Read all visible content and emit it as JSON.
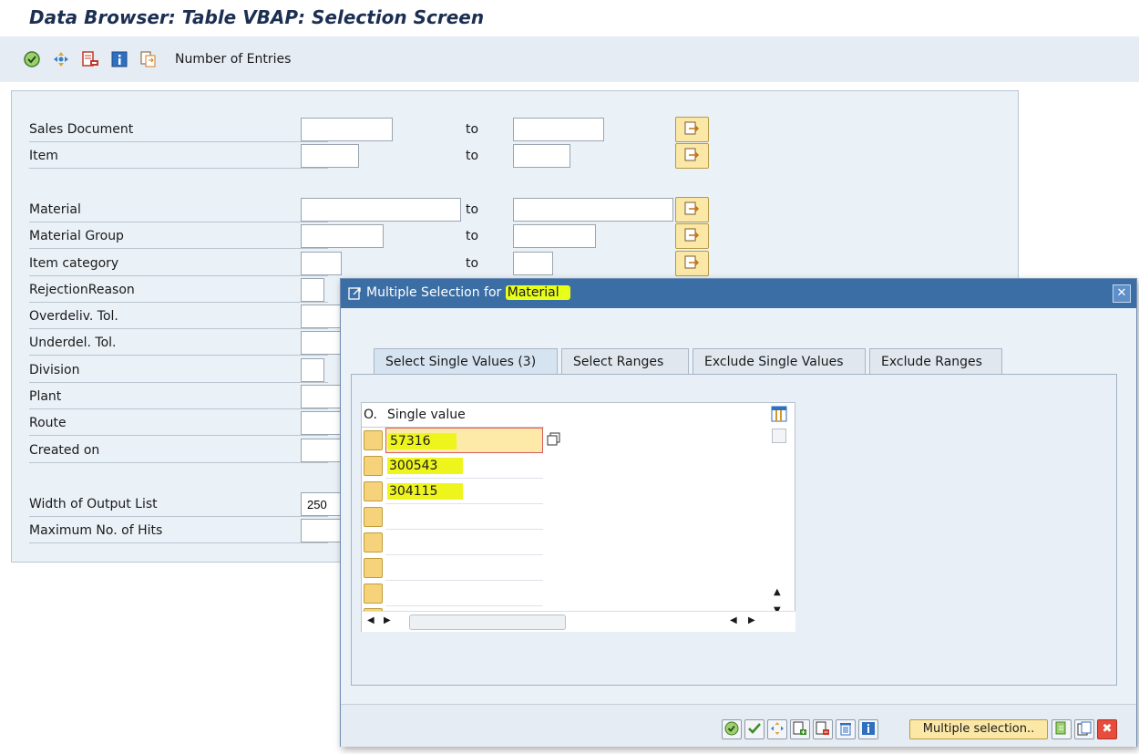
{
  "window": {
    "title": "Data Browser: Table VBAP: Selection Screen"
  },
  "toolbar": {
    "icons": [
      "execute-icon",
      "selection-options-icon",
      "delete-selection-icon",
      "info-icon",
      "multiple-selection-icon"
    ],
    "number_of_entries_label": "Number of Entries"
  },
  "selection": {
    "to_label": "to",
    "fields": [
      {
        "label": "Sales Document",
        "low": "",
        "high": ""
      },
      {
        "label": "Item",
        "low": "",
        "high": ""
      },
      {
        "label": "Material",
        "low": "",
        "high": ""
      },
      {
        "label": "Material Group",
        "low": "",
        "high": ""
      },
      {
        "label": "Item category",
        "low": "",
        "high": ""
      },
      {
        "label": "RejectionReason",
        "low": ""
      },
      {
        "label": "Overdeliv. Tol.",
        "low": ""
      },
      {
        "label": "Underdel. Tol.",
        "low": ""
      },
      {
        "label": "Division",
        "low": ""
      },
      {
        "label": "Plant",
        "low": ""
      },
      {
        "label": "Route",
        "low": ""
      },
      {
        "label": "Created on",
        "low": ""
      },
      {
        "label": "Width of Output List",
        "low": "250"
      },
      {
        "label": "Maximum No. of Hits",
        "low": ""
      }
    ]
  },
  "dialog": {
    "title_prefix": "Multiple Selection for ",
    "title_field": "Material",
    "close_icon": "close-icon",
    "tabs": [
      {
        "label": "Select Single Values (3)"
      },
      {
        "label": "Select Ranges"
      },
      {
        "label": "Exclude Single Values"
      },
      {
        "label": "Exclude Ranges"
      }
    ],
    "grid": {
      "col_option": "O.",
      "col_value": "Single value",
      "values": [
        "57316",
        "300543",
        "304115",
        "",
        "",
        "",
        "",
        ""
      ]
    },
    "footer": {
      "multiple_selection_label": "Multiple selection.."
    }
  }
}
